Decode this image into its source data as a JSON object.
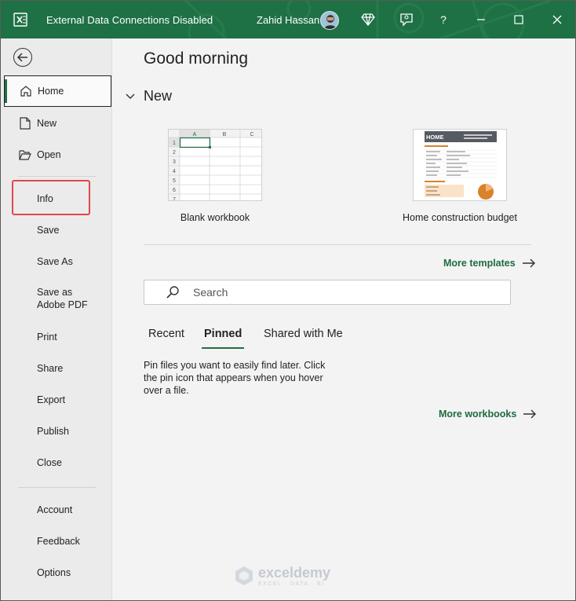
{
  "window": {
    "doc_title": "External Data Connections Disabled",
    "user_name": "Zahid Hassan",
    "buttons": [
      "diamond-icon",
      "feedback-icon",
      "help",
      "minimize",
      "maximize",
      "close"
    ],
    "help_label": "?",
    "accent_color": "#1e7145"
  },
  "sidebar": {
    "items_top": [
      {
        "label": "Home",
        "icon": "home-icon",
        "selected": true
      },
      {
        "label": "New",
        "icon": "new-doc-icon"
      },
      {
        "label": "Open",
        "icon": "folder-open-icon"
      }
    ],
    "items_mid": [
      "Info",
      "Save",
      "Save As",
      "Save as Adobe PDF",
      "Print",
      "Share",
      "Export",
      "Publish",
      "Close"
    ],
    "items_bottom": [
      "Account",
      "Feedback",
      "Options"
    ],
    "highlighted": "Info",
    "highlight_color": "#e0474c"
  },
  "main": {
    "greeting": "Good morning",
    "new_section": "New",
    "templates": [
      {
        "label": "Blank workbook"
      },
      {
        "label": "Home construction budget"
      }
    ],
    "blank_grid": {
      "columns": [
        "A",
        "B",
        "C"
      ],
      "rows": [
        "1",
        "2",
        "3",
        "4",
        "5",
        "6",
        "7"
      ]
    },
    "budget_thumb_title": "HOME",
    "more_templates": "More templates",
    "search_placeholder": "Search",
    "tabs": [
      "Recent",
      "Pinned",
      "Shared with Me"
    ],
    "active_tab": "Pinned",
    "pinned_message": "Pin files you want to easily find later. Click the pin icon that appears when you hover over a file.",
    "more_workbooks": "More workbooks"
  },
  "watermark": {
    "name": "exceldemy",
    "tagline": "EXCEL · DATA · BI"
  }
}
